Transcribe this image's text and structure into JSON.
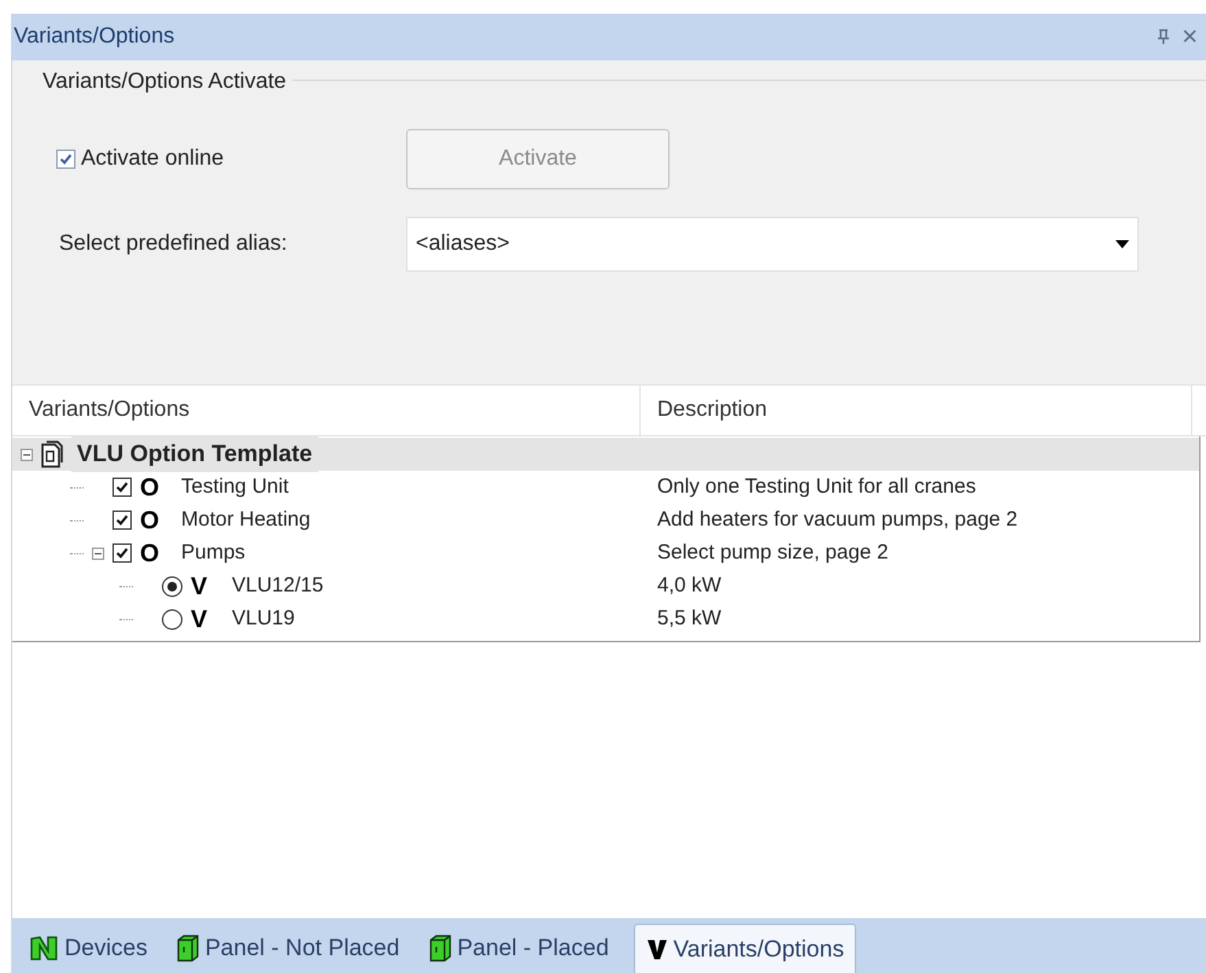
{
  "window": {
    "title": "Variants/Options",
    "close": "×"
  },
  "group": {
    "title": "Variants/Options Activate",
    "activate_online": {
      "label": "Activate online",
      "checked": true
    },
    "activate_button": {
      "label": "Activate",
      "disabled": true
    },
    "alias": {
      "label": "Select predefined alias:",
      "value": "<aliases>"
    }
  },
  "table": {
    "columns": [
      "Variants/Options",
      "Description"
    ],
    "rows": [
      {
        "kind": "template",
        "name": "VLU Option Template",
        "description": "",
        "expanded": true,
        "selected": true,
        "children": [
          {
            "kind": "option",
            "type": "O",
            "name": "Testing Unit",
            "checked": true,
            "description": "Only one Testing Unit for all cranes"
          },
          {
            "kind": "option",
            "type": "O",
            "name": "Motor Heating",
            "checked": true,
            "description": "Add heaters for vacuum pumps, page 2"
          },
          {
            "kind": "option",
            "type": "O",
            "name": "Pumps",
            "checked": true,
            "expanded": true,
            "description": "Select pump size, page 2",
            "children": [
              {
                "kind": "variant",
                "type": "V",
                "name": "VLU12/15",
                "checked": true,
                "description": "4,0 kW"
              },
              {
                "kind": "variant",
                "type": "V",
                "name": "VLU19",
                "checked": false,
                "description": "5,5 kW"
              }
            ]
          }
        ]
      }
    ]
  },
  "bottom_tabs": [
    {
      "label": "Devices",
      "kind": "devices",
      "selected": false
    },
    {
      "label": "Panel - Not Placed",
      "kind": "panel",
      "selected": false
    },
    {
      "label": "Panel - Placed",
      "kind": "panel",
      "selected": false
    },
    {
      "label": "Variants/Options",
      "kind": "variant",
      "selected": true
    }
  ]
}
